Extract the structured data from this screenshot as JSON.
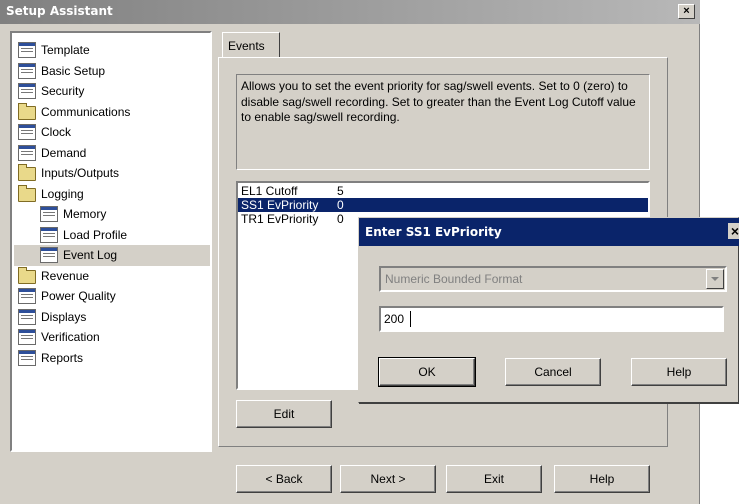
{
  "window": {
    "title": "Setup Assistant",
    "close_glyph": "×"
  },
  "tree": {
    "items": [
      {
        "label": "Template",
        "icon": "page-icon",
        "indent": 0
      },
      {
        "label": "Basic Setup",
        "icon": "page-icon",
        "indent": 0
      },
      {
        "label": "Security",
        "icon": "page-icon",
        "indent": 0
      },
      {
        "label": "Communications",
        "icon": "folder-icon",
        "indent": 0
      },
      {
        "label": "Clock",
        "icon": "page-icon",
        "indent": 0
      },
      {
        "label": "Demand",
        "icon": "page-icon",
        "indent": 0
      },
      {
        "label": "Inputs/Outputs",
        "icon": "folder-icon",
        "indent": 0
      },
      {
        "label": "Logging",
        "icon": "folder-icon",
        "indent": 0
      },
      {
        "label": "Memory",
        "icon": "page-icon",
        "indent": 1
      },
      {
        "label": "Load Profile",
        "icon": "page-icon",
        "indent": 1
      },
      {
        "label": "Event Log",
        "icon": "page-icon",
        "indent": 1,
        "selected": true
      },
      {
        "label": "Revenue",
        "icon": "folder-icon",
        "indent": 0
      },
      {
        "label": "Power Quality",
        "icon": "page-icon",
        "indent": 0
      },
      {
        "label": "Displays",
        "icon": "page-icon",
        "indent": 0
      },
      {
        "label": "Verification",
        "icon": "page-icon",
        "indent": 0
      },
      {
        "label": "Reports",
        "icon": "page-icon",
        "indent": 0
      }
    ]
  },
  "tab": {
    "label": "Events"
  },
  "description": "Allows you to set the event priority for sag/swell events. Set to 0 (zero) to disable sag/swell recording. Set to greater than the Event Log Cutoff value to enable sag/swell recording.",
  "list": {
    "rows": [
      {
        "key": "EL1 Cutoff",
        "value": "5"
      },
      {
        "key": "SS1 EvPriority",
        "value": "0",
        "selected": true
      },
      {
        "key": "TR1 EvPriority",
        "value": "0"
      }
    ]
  },
  "edit_button": "Edit",
  "footer": {
    "back": "< Back",
    "next": "Next >",
    "exit": "Exit",
    "help": "Help"
  },
  "dialog": {
    "title": "Enter SS1 EvPriority",
    "close_glyph": "×",
    "format_select": "Numeric Bounded Format",
    "value_input": "200",
    "ok": "OK",
    "cancel": "Cancel",
    "help": "Help"
  }
}
